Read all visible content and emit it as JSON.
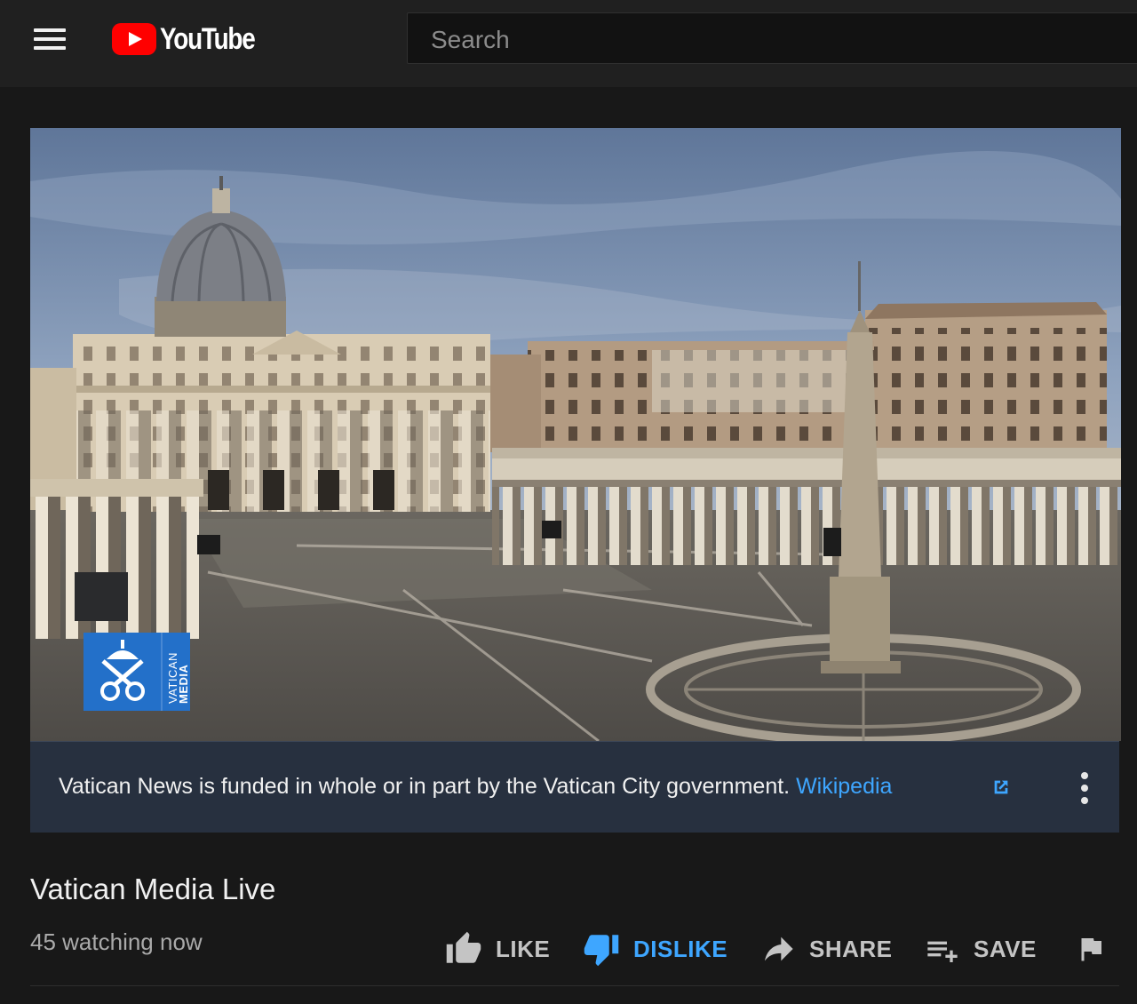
{
  "header": {
    "logo_text": "YouTube",
    "search": {
      "placeholder": "Search",
      "value": ""
    }
  },
  "player": {
    "channel_logo_text": [
      "VATICAN",
      "MEDIA"
    ]
  },
  "info_panel": {
    "text": "Vatican News is funded in whole or in part by the Vatican City government.",
    "link_text": "Wikipedia",
    "link_color": "#3ea6ff"
  },
  "video": {
    "title": "Vatican Media Live",
    "viewers": "45 watching now"
  },
  "actions": {
    "like": "LIKE",
    "dislike": "DISLIKE",
    "share": "SHARE",
    "save": "SAVE",
    "active_color": "#3ea6ff"
  },
  "colors": {
    "background": "#181818",
    "header": "#202020",
    "brand_red": "#ff0000",
    "info_panel": "#27303f"
  }
}
